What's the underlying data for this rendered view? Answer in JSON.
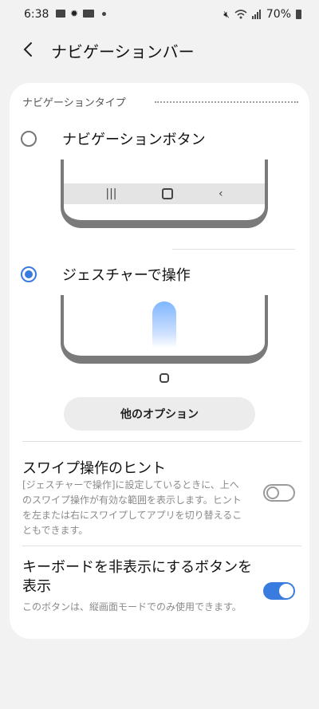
{
  "status": {
    "time": "6:38",
    "left_icons": [
      "image-icon",
      "settings-icon",
      "youtube-icon",
      "notification-dot"
    ],
    "right_icons": [
      "mute-icon",
      "wifi-icon",
      "signal-icon",
      "battery-icon"
    ],
    "battery": "70%"
  },
  "appbar": {
    "back_icon": "back-icon",
    "title": "ナビゲーションバー"
  },
  "nav_type": {
    "heading": "ナビゲーションタイプ",
    "options": [
      {
        "label": "ナビゲーションボタン",
        "selected": false
      },
      {
        "label": "ジェスチャーで操作",
        "selected": true
      }
    ],
    "preview_buttons": [
      "recents-icon",
      "home-icon",
      "back-icon"
    ],
    "more_options": "他のオプション"
  },
  "settings": [
    {
      "title": "スワイプ操作のヒント",
      "desc": "[ジェスチャーで操作]に設定しているときに、上へのスワイプ操作が有効な範囲を表示します。ヒントを左または右にスワイプしてアプリを切り替えることもできます。",
      "enabled": false
    },
    {
      "title": "キーボードを非表示にするボタンを表示",
      "desc": "このボタンは、縦画面モードでのみ使用できます。",
      "enabled": true
    }
  ],
  "colors": {
    "accent": "#3a7be0",
    "background": "#f2f2f2",
    "card": "#ffffff"
  }
}
